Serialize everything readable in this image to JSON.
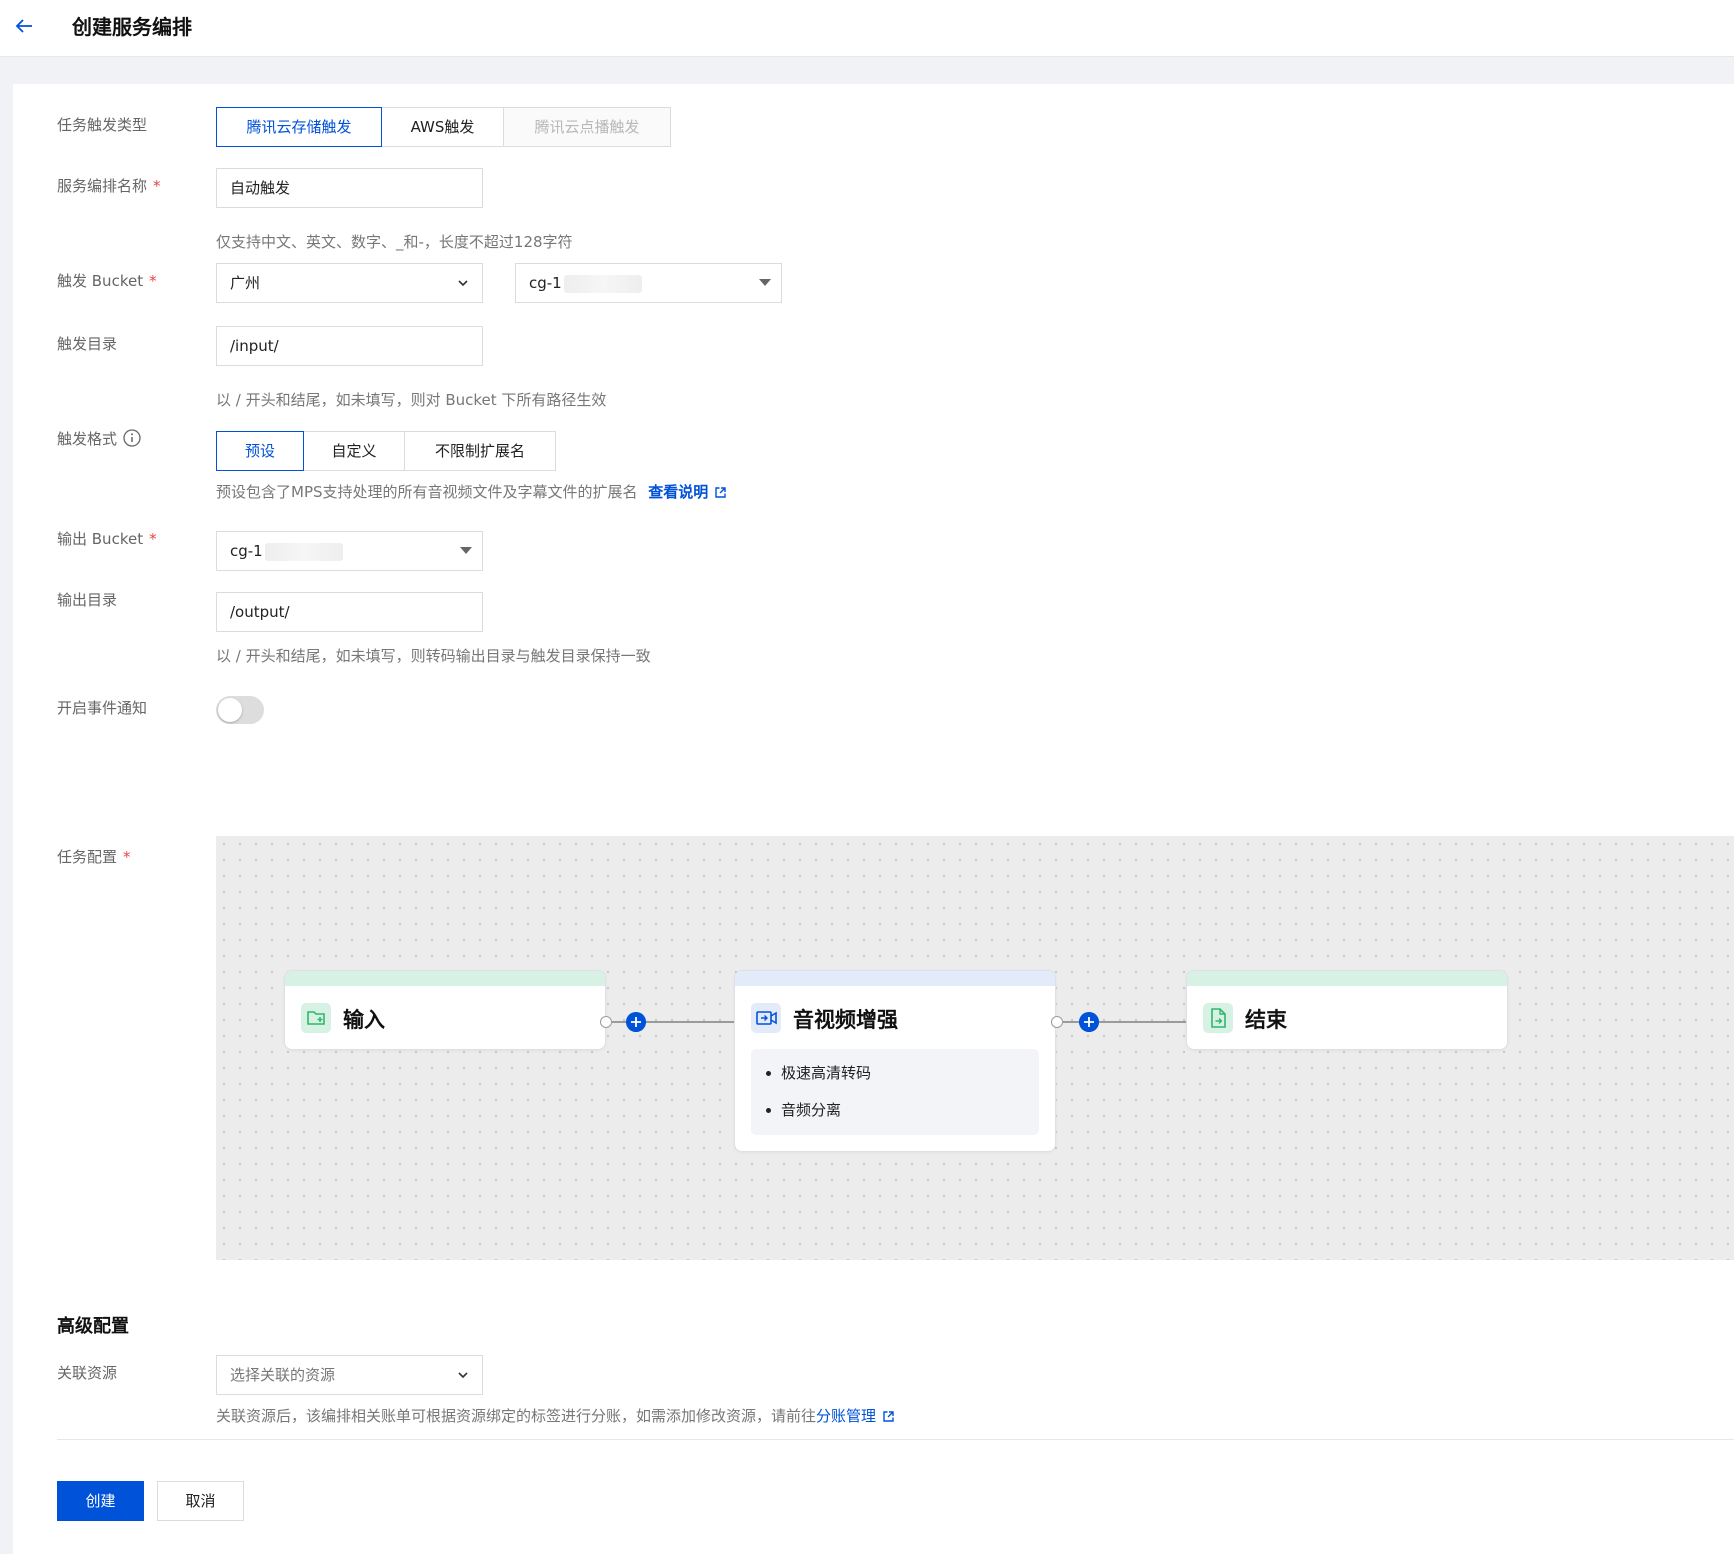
{
  "header": {
    "title": "创建服务编排"
  },
  "form": {
    "trigger_type": {
      "label": "任务触发类型",
      "options": [
        {
          "label": "腾讯云存储触发",
          "state": "active"
        },
        {
          "label": "AWS触发",
          "state": "normal"
        },
        {
          "label": "腾讯云点播触发",
          "state": "disabled"
        }
      ]
    },
    "name": {
      "label": "服务编排名称",
      "value": "自动触发",
      "hint": "仅支持中文、英文、数字、_和-，长度不超过128字符"
    },
    "trigger_bucket": {
      "label": "触发 Bucket",
      "region": "广州",
      "bucket": "cg-1"
    },
    "trigger_dir": {
      "label": "触发目录",
      "value": "/input/",
      "hint": "以 / 开头和结尾，如未填写，则对 Bucket 下所有路径生效"
    },
    "trigger_format": {
      "label": "触发格式",
      "options": [
        {
          "label": "预设",
          "state": "active"
        },
        {
          "label": "自定义",
          "state": "normal"
        },
        {
          "label": "不限制扩展名",
          "state": "normal"
        }
      ],
      "hint": "预设包含了MPS支持处理的所有音视频文件及字幕文件的扩展名",
      "link": "查看说明"
    },
    "output_bucket": {
      "label": "输出 Bucket",
      "value": "cg-1"
    },
    "output_dir": {
      "label": "输出目录",
      "value": "/output/",
      "hint": "以 / 开头和结尾，如未填写，则转码输出目录与触发目录保持一致"
    },
    "event_notify": {
      "label": "开启事件通知",
      "enabled": false
    },
    "task_config": {
      "label": "任务配置",
      "nodes": [
        {
          "title": "输入",
          "icon": "folder-add-icon",
          "accent": "#d7f2e4",
          "tasks": []
        },
        {
          "title": "音视频增强",
          "icon": "video-enhance-icon",
          "accent": "#e3ebfb",
          "tasks": [
            "极速高清转码",
            "音频分离"
          ]
        },
        {
          "title": "结束",
          "icon": "file-end-icon",
          "accent": "#d7f2e4",
          "tasks": []
        }
      ]
    }
  },
  "advanced": {
    "title": "高级配置",
    "resource": {
      "label": "关联资源",
      "placeholder": "选择关联的资源",
      "hint": "关联资源后，该编排相关账单可根据资源绑定的标签进行分账，如需添加修改资源，请前往",
      "link": "分账管理"
    }
  },
  "actions": {
    "create": "创建",
    "cancel": "取消"
  },
  "colors": {
    "primary": "#0052d9",
    "required": "#e54545",
    "success_icon": "#2fb76b"
  }
}
